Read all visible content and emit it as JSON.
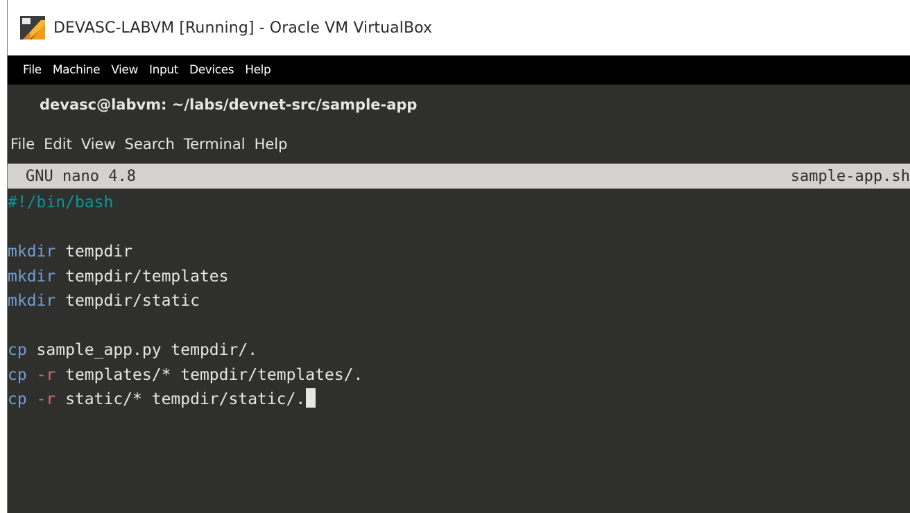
{
  "window": {
    "title": "DEVASC-LABVM [Running] - Oracle VM VirtualBox"
  },
  "vbox_menu": [
    "File",
    "Machine",
    "View",
    "Input",
    "Devices",
    "Help"
  ],
  "terminal": {
    "title": "devasc@labvm: ~/labs/devnet-src/sample-app",
    "menu": [
      "File",
      "Edit",
      "View",
      "Search",
      "Terminal",
      "Help"
    ]
  },
  "nano": {
    "version_label": "GNU nano 4.8",
    "filename": "sample-app.sh",
    "lines": [
      {
        "comment": "#!/bin/bash"
      },
      {},
      {
        "cmd": "mkdir",
        "rest": " tempdir"
      },
      {
        "cmd": "mkdir",
        "rest": " tempdir/templates"
      },
      {
        "cmd": "mkdir",
        "rest": " tempdir/static"
      },
      {},
      {
        "cmd": "cp",
        "rest": " sample_app.py tempdir/."
      },
      {
        "cmd": "cp",
        "opt": " -r",
        "rest": " templates/* tempdir/templates/."
      },
      {
        "cmd": "cp",
        "opt": " -r",
        "rest": " static/* tempdir/static/.",
        "cursor": true
      }
    ]
  },
  "colors": {
    "terminal_bg": "#2f2f2d",
    "nano_bar_bg": "#d3d2ce",
    "comment": "#06989a",
    "command": "#729fcf",
    "option": "#cc6f6f"
  }
}
